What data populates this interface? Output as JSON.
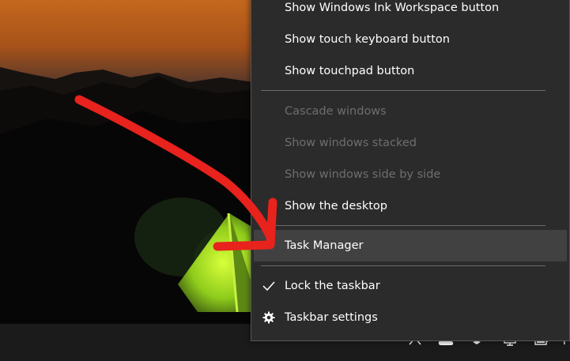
{
  "context_menu": {
    "items": [
      {
        "label": "Show Windows Ink Workspace button",
        "enabled": true
      },
      {
        "label": "Show touch keyboard button",
        "enabled": true
      },
      {
        "label": "Show touchpad button",
        "enabled": true
      },
      {
        "label": "Cascade windows",
        "enabled": false
      },
      {
        "label": "Show windows stacked",
        "enabled": false
      },
      {
        "label": "Show windows side by side",
        "enabled": false
      },
      {
        "label": "Show the desktop",
        "enabled": true
      },
      {
        "label": "Task Manager",
        "enabled": true,
        "highlighted": true
      },
      {
        "label": "Lock the taskbar",
        "enabled": true,
        "checked": true,
        "icon": "checkmark-icon"
      },
      {
        "label": "Taskbar settings",
        "enabled": true,
        "icon": "gear-icon"
      }
    ]
  },
  "tray": {
    "icons": [
      "chevron-up-icon",
      "cloud-icon",
      "dropbox-icon",
      "network-icon",
      "battery-icon",
      "volume-icon"
    ]
  },
  "annotation": {
    "color": "#e8221c",
    "points_to": "Task Manager"
  },
  "colors": {
    "menu_bg": "#2b2b2b",
    "highlight": "#414141",
    "disabled_text": "#6e6e6e",
    "taskbar": "#1b1b1b"
  }
}
